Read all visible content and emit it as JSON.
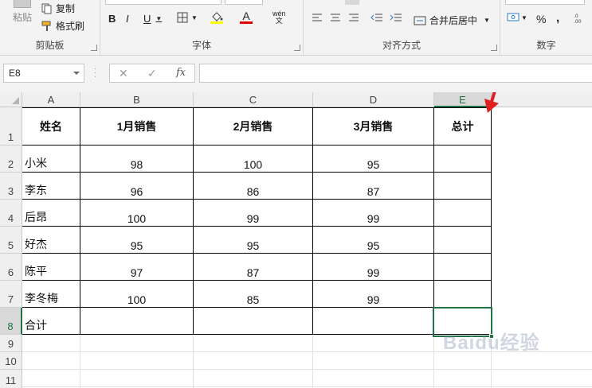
{
  "ribbon": {
    "clipboard": {
      "label": "剪贴板",
      "paste_label": "粘贴",
      "copy_label": "复制",
      "format_painter_label": "格式刷"
    },
    "font": {
      "label": "字体",
      "bold": "B",
      "italic": "I",
      "underline": "U",
      "font_color_glyph": "A",
      "phonetic_glyph": "wén\n文"
    },
    "alignment": {
      "label": "对齐方式",
      "merge_label": "合并后居中"
    },
    "number": {
      "label": "数字",
      "percent": "%",
      "comma": ","
    }
  },
  "formula_bar": {
    "name_box": "E8",
    "cancel": "✕",
    "enter": "✓",
    "fx": "fx",
    "value": ""
  },
  "columns": [
    "A",
    "B",
    "C",
    "D",
    "E"
  ],
  "rows": [
    "1",
    "2",
    "3",
    "4",
    "5",
    "6",
    "7",
    "8",
    "9",
    "10",
    "11"
  ],
  "table": {
    "headers": [
      "姓名",
      "1月销售",
      "2月销售",
      "3月销售",
      "总计"
    ],
    "data": [
      [
        "小米",
        "98",
        "100",
        "95",
        ""
      ],
      [
        "李东",
        "96",
        "86",
        "87",
        ""
      ],
      [
        "后昂",
        "100",
        "99",
        "99",
        ""
      ],
      [
        "好杰",
        "95",
        "95",
        "95",
        ""
      ],
      [
        "陈平",
        "97",
        "87",
        "99",
        ""
      ],
      [
        "李冬梅",
        "100",
        "85",
        "99",
        ""
      ],
      [
        "合计",
        "",
        "",
        "",
        ""
      ]
    ]
  },
  "selected_cell": "E8",
  "colors": {
    "accent": "#217346",
    "arrow": "#e02020"
  },
  "watermark": "Baidu经验"
}
